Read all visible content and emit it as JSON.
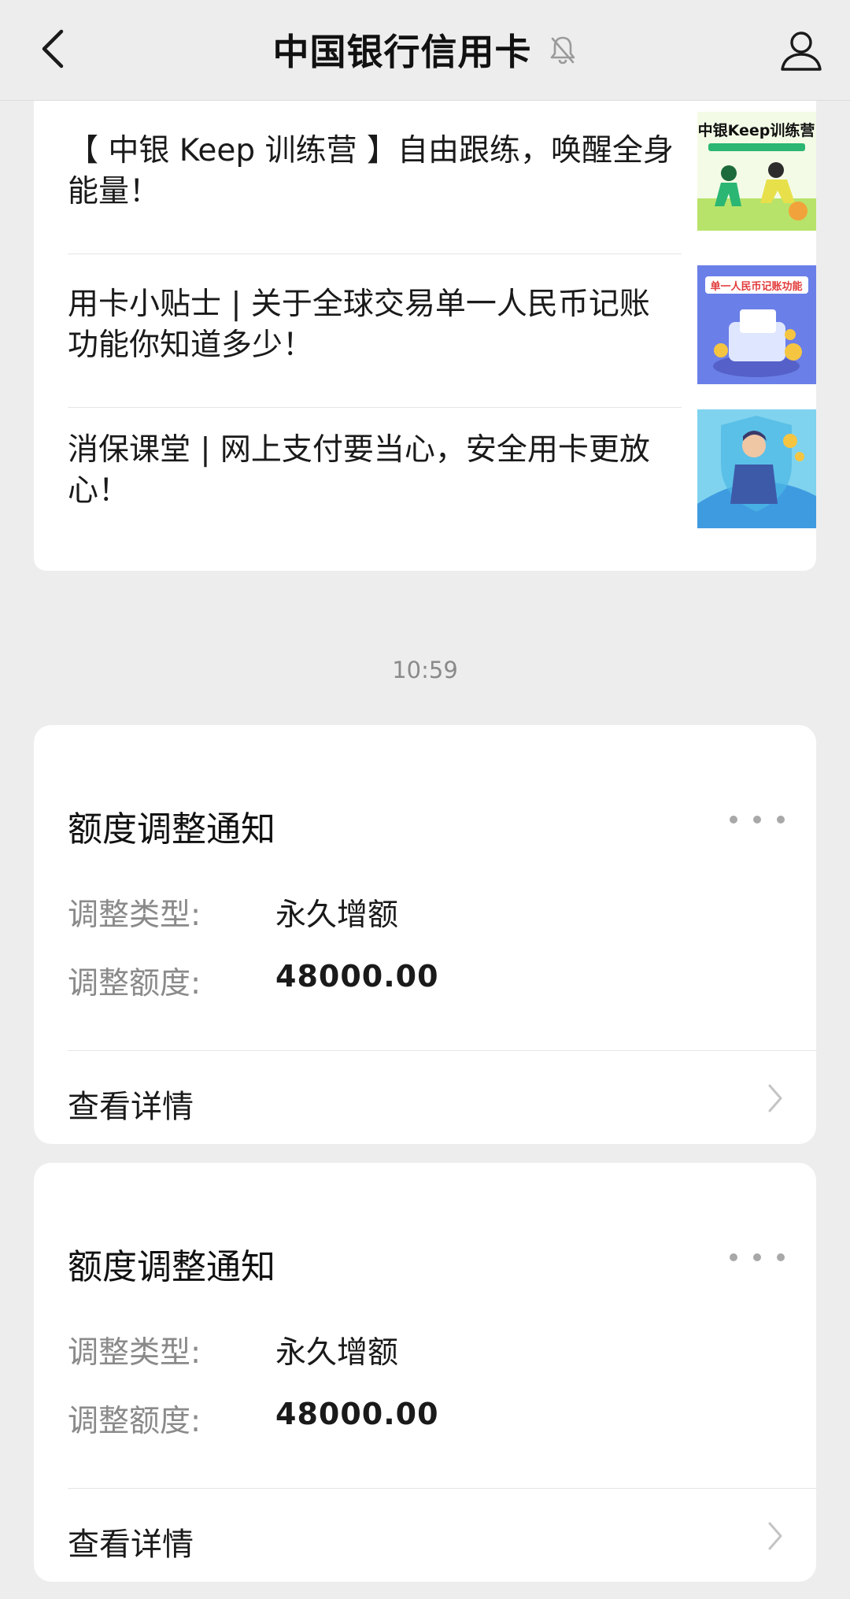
{
  "header": {
    "title": "中国银行信用卡",
    "back_icon": "chevron-left-icon",
    "mute_icon": "bell-off-icon",
    "profile_icon": "user-icon"
  },
  "articles": [
    {
      "title": "【 中银 Keep 训练营 】自由跟练，唤醒全身能量！",
      "thumb_icon": "keep-training-thumbnail",
      "thumb_caption": "中银Keep训练营"
    },
    {
      "title": "用卡小贴士 | 关于全球交易单一人民币记账功能你知道多少！",
      "thumb_icon": "rmb-billing-thumbnail",
      "thumb_caption": "单一人民币记账功能"
    },
    {
      "title": "消保课堂 | 网上支付要当心，安全用卡更放心！",
      "thumb_icon": "safe-payment-thumbnail"
    }
  ],
  "timestamp": "10:59",
  "notices": [
    {
      "title": "额度调整通知",
      "type_label": "调整类型:",
      "type_value": "永久增额",
      "amount_label": "调整额度:",
      "amount_value": "48000.00",
      "details_label": "查看详情"
    },
    {
      "title": "额度调整通知",
      "type_label": "调整类型:",
      "type_value": "永久增额",
      "amount_label": "调整额度:",
      "amount_value": "48000.00",
      "details_label": "查看详情"
    }
  ],
  "colors": {
    "background": "#ededed",
    "card": "#ffffff",
    "label_gray": "#8a8a8a",
    "text": "#1a1a1a"
  }
}
